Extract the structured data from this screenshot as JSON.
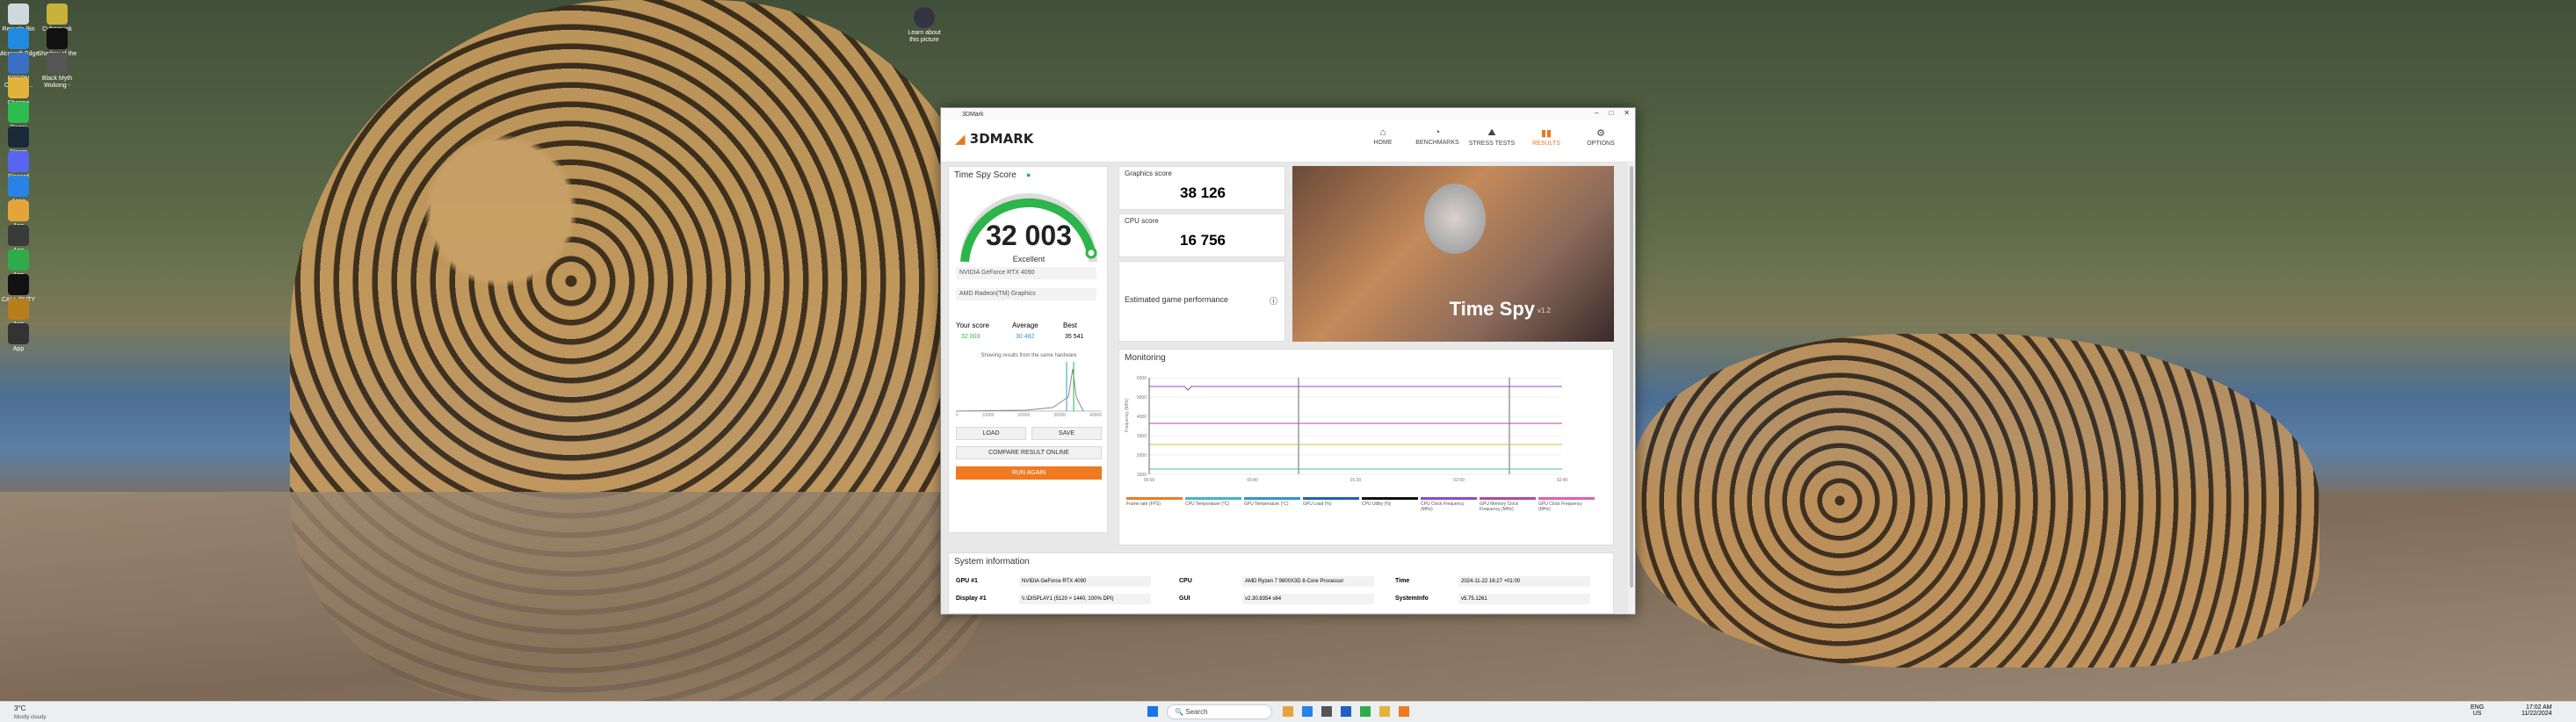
{
  "desktop": {
    "icons": [
      {
        "label": "Recycle Bin",
        "color": "#cfd8dc"
      },
      {
        "label": "Cyberpunk 2077",
        "color": "#c9b13a"
      },
      {
        "label": "Microsoft Edge",
        "color": "#1f8adf"
      },
      {
        "label": "Shadow of the Tomb...",
        "color": "#111"
      },
      {
        "label": "EPSON Orchestr...",
        "color": "#3a6fc4"
      },
      {
        "label": "Black Myth Wukong -",
        "color": "#555"
      },
      {
        "label": "Chrome",
        "color": "#e2b33b"
      },
      {
        "label": "Razer",
        "color": "#2ebc4f"
      },
      {
        "label": "Steam",
        "color": "#1b2838"
      },
      {
        "label": "Discord",
        "color": "#5865f2"
      },
      {
        "label": "Apps",
        "color": "#2a82e4"
      },
      {
        "label": "App",
        "color": "#e3a53a"
      },
      {
        "label": "App",
        "color": "#3a3a3a"
      },
      {
        "label": "App",
        "color": "#2eac4b"
      },
      {
        "label": "CALL DUTY",
        "color": "#111"
      },
      {
        "label": "App",
        "color": "#b87e1b"
      },
      {
        "label": "App",
        "color": "#333"
      }
    ],
    "center_icon": {
      "label": "Learn about this picture"
    }
  },
  "window": {
    "title": "3DMark",
    "logo": "3DMARK",
    "nav": [
      {
        "label": "HOME",
        "glyph": "⌂"
      },
      {
        "label": "BENCHMARKS",
        "glyph": "◔"
      },
      {
        "label": "STRESS TESTS",
        "glyph": "⛰"
      },
      {
        "label": "RESULTS",
        "glyph": "▮▮"
      },
      {
        "label": "OPTIONS",
        "glyph": "⚙"
      }
    ],
    "score": {
      "title": "Time Spy Score",
      "value": "32 003",
      "rating": "Excellent",
      "gpu": "NVIDIA GeForce RTX 4090",
      "igpu": "AMD Radeon(TM) Graphics",
      "your_label": "Your score",
      "your_value": "32 003",
      "avg_label": "Average",
      "avg_value": "30 482",
      "best_label": "Best",
      "best_value": "35 541",
      "note": "Showing results from the same hardware",
      "load": "LOAD",
      "save": "SAVE",
      "compare": "COMPARE RESULT ONLINE",
      "run": "RUN AGAIN",
      "dist_ticks": [
        "0",
        "10000",
        "20000",
        "30000",
        "40000"
      ]
    },
    "graphics": {
      "label": "Graphics score",
      "value": "38 126"
    },
    "cpu": {
      "label": "CPU score",
      "value": "16 756"
    },
    "estimated": {
      "label": "Estimated game performance"
    },
    "banner": {
      "title": "Time Spy",
      "version": "v1.2"
    },
    "monitoring": {
      "title": "Monitoring",
      "ylabel": "Frequency (MHz)",
      "yticks": [
        "6000",
        "5000",
        "4000",
        "3000",
        "2000",
        "1000"
      ],
      "xticks": [
        "00:00",
        "00:40",
        "01:20",
        "02:00",
        "02:40"
      ],
      "legend": [
        {
          "label": "Frame rate (FPS)",
          "color": "#ef7a22"
        },
        {
          "label": "CPU Temperature (°C)",
          "color": "#3fb8c7"
        },
        {
          "label": "GPU Temperature (°C)",
          "color": "#2a98d4"
        },
        {
          "label": "GPU Load (%)",
          "color": "#1f5fbf"
        },
        {
          "label": "CPU Utility (%)",
          "color": "#111"
        },
        {
          "label": "CPU Clock Frequency (MHz)",
          "color": "#8a4ad0"
        },
        {
          "label": "GPU Memory Clock Frequency (MHz)",
          "color": "#b04a9e"
        },
        {
          "label": "GPU Clock Frequency (MHz)",
          "color": "#e05fb5"
        }
      ]
    },
    "sysinfo": {
      "title": "System information",
      "gpu_label": "GPU #1",
      "gpu_value": "NVIDIA GeForce RTX 4090",
      "display_label": "Display #1",
      "display_value": "\\\\.\\DISPLAY1 (5120 × 1440, 100% DPI)",
      "cpu_label": "CPU",
      "cpu_value": "AMD Ryzen 7 9800X3D 8-Core Processor",
      "gui_label": "GUI",
      "gui_value": "v2.30.8354 s64",
      "time_label": "Time",
      "time_value": "2024-11-22 16:27 +01:00",
      "si_label": "SystemInfo",
      "si_value": "v5.75.1261"
    }
  },
  "taskbar": {
    "search": "Search",
    "weather": "3°C",
    "weather_sub": "Mostly cloudy",
    "lang": "ENG",
    "lang_sub": "US",
    "time": "17:02 AM",
    "date": "11/22/2024"
  }
}
